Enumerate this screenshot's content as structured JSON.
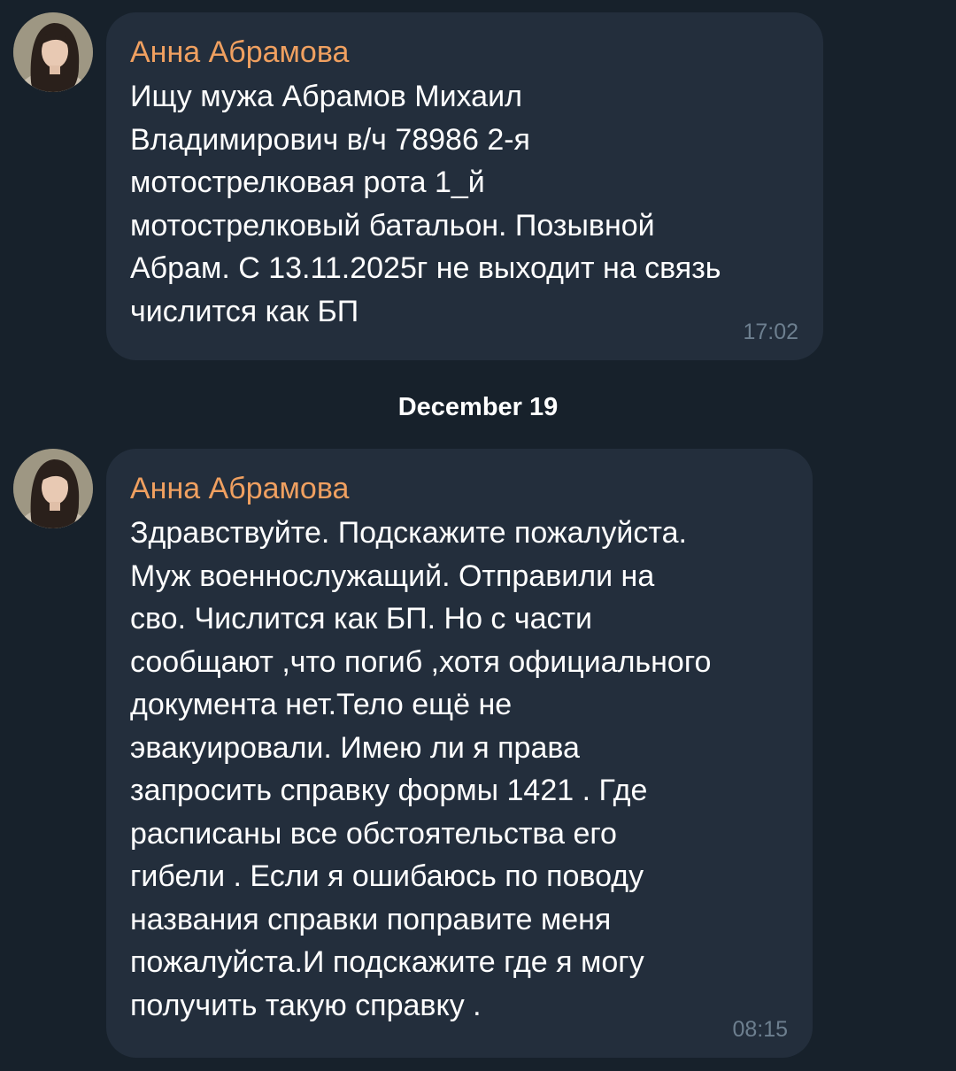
{
  "messages": [
    {
      "sender": "Анна Абрамова",
      "text": "Ищу мужа Абрамов Михаил\nВладимирович в/ч 78986 2-я\nмотострелковая рота 1_й\nмотострелковый батальон. Позывной\nАбрам. С 13.11.2025г не выходит на связь\nчислится как БП",
      "time": "17:02"
    },
    {
      "sender": "Анна Абрамова",
      "text": "Здравствуйте. Подскажите пожалуйста.\nМуж военнослужащий. Отправили на\nсво. Числится как БП. Но с части\nсообщают ,что погиб ,хотя официального\nдокумента нет.Тело ещё не\nэвакуировали. Имею ли я права\nзапросить справку формы 1421 . Где\nрасписаны все обстоятельства его\nгибели . Если я ошибаюсь по поводу\nназвания справки поправите меня\nпожалуйста.И подскажите где я могу\nполучить такую справку .",
      "time": "08:15"
    }
  ],
  "date_separator": "December 19",
  "colors": {
    "background": "#17212b",
    "bubble": "#232e3c",
    "sender_name": "#f0a060",
    "message_text": "#ffffff",
    "timestamp": "#6d7f8f"
  },
  "icons": {
    "avatar": "user-photo-avatar"
  }
}
